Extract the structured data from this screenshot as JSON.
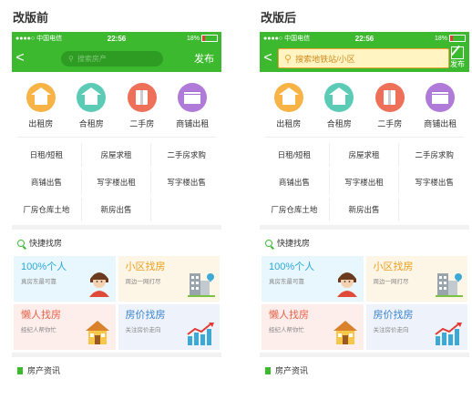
{
  "captions": {
    "before": "改版前",
    "after": "改版后"
  },
  "status": {
    "signal": "●●●●○ 中国电信",
    "time": "22:56",
    "battery": "18%"
  },
  "nav": {
    "back": "<",
    "search_placeholder_old": "搜索房产",
    "publish_old": "发布",
    "search_placeholder_new": "搜索地铁站/小区",
    "publish_new": "发布"
  },
  "icons": [
    {
      "label": "出租房",
      "color": "#f7b346",
      "icon": "house-icon"
    },
    {
      "label": "合租房",
      "color": "#5ccbb6",
      "icon": "house-icon"
    },
    {
      "label": "二手房",
      "color": "#ee7058",
      "icon": "building-icon"
    },
    {
      "label": "商铺出租",
      "color": "#b07ad8",
      "icon": "shop-icon"
    }
  ],
  "links": [
    "日租/短租",
    "房屋求租",
    "二手房求购",
    "商铺出售",
    "写字楼出租",
    "写字楼出售",
    "厂房仓库土地",
    "新房出售"
  ],
  "quick": {
    "title": "快捷找房",
    "cards": [
      {
        "title": "100%个人",
        "sub": "真房东最可靠"
      },
      {
        "title": "小区找房",
        "sub": "周边一网打尽"
      },
      {
        "title": "懒人找房",
        "sub": "经纪人帮你忙"
      },
      {
        "title": "房价找房",
        "sub": "关注房价走向"
      }
    ]
  },
  "news": {
    "title": "房产资讯"
  }
}
